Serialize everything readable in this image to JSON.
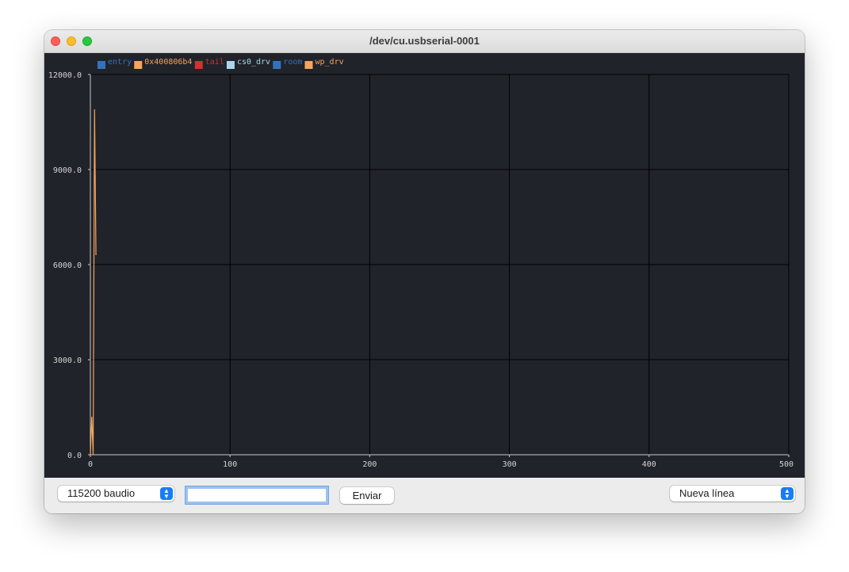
{
  "window": {
    "title": "/dev/cu.usbserial-0001"
  },
  "legend": [
    {
      "label": "entry",
      "color": "#3273b8"
    },
    {
      "label": "0x400806b4",
      "color": "#f5a55c"
    },
    {
      "label": "tail",
      "color": "#d0332e"
    },
    {
      "label": "cs0_drv",
      "color": "#a9d5ec"
    },
    {
      "label": "room",
      "color": "#3273b8"
    },
    {
      "label": "wp_drv",
      "color": "#f5a55c"
    }
  ],
  "chart_data": {
    "type": "line",
    "xlim": [
      0,
      500
    ],
    "ylim": [
      0,
      12000
    ],
    "x_ticks": [
      0,
      100,
      200,
      300,
      400,
      500
    ],
    "y_ticks": [
      0,
      3000,
      6000,
      9000,
      12000
    ],
    "x_tick_labels": [
      "0",
      "100",
      "200",
      "300",
      "400",
      "500"
    ],
    "y_tick_labels": [
      "0.0",
      "3000.0",
      "6000.0",
      "9000.0",
      "12000.0"
    ],
    "grid": true,
    "series": [
      {
        "name": "0x400806b4",
        "color": "#f5a55c",
        "x": [
          0,
          1,
          2,
          3,
          4
        ],
        "y": [
          0,
          1200,
          0,
          10900,
          6300
        ]
      }
    ]
  },
  "bottom_bar": {
    "baud_select": "115200 baudio",
    "message_input": "",
    "send_button": "Enviar",
    "line_ending_select": "Nueva línea"
  }
}
